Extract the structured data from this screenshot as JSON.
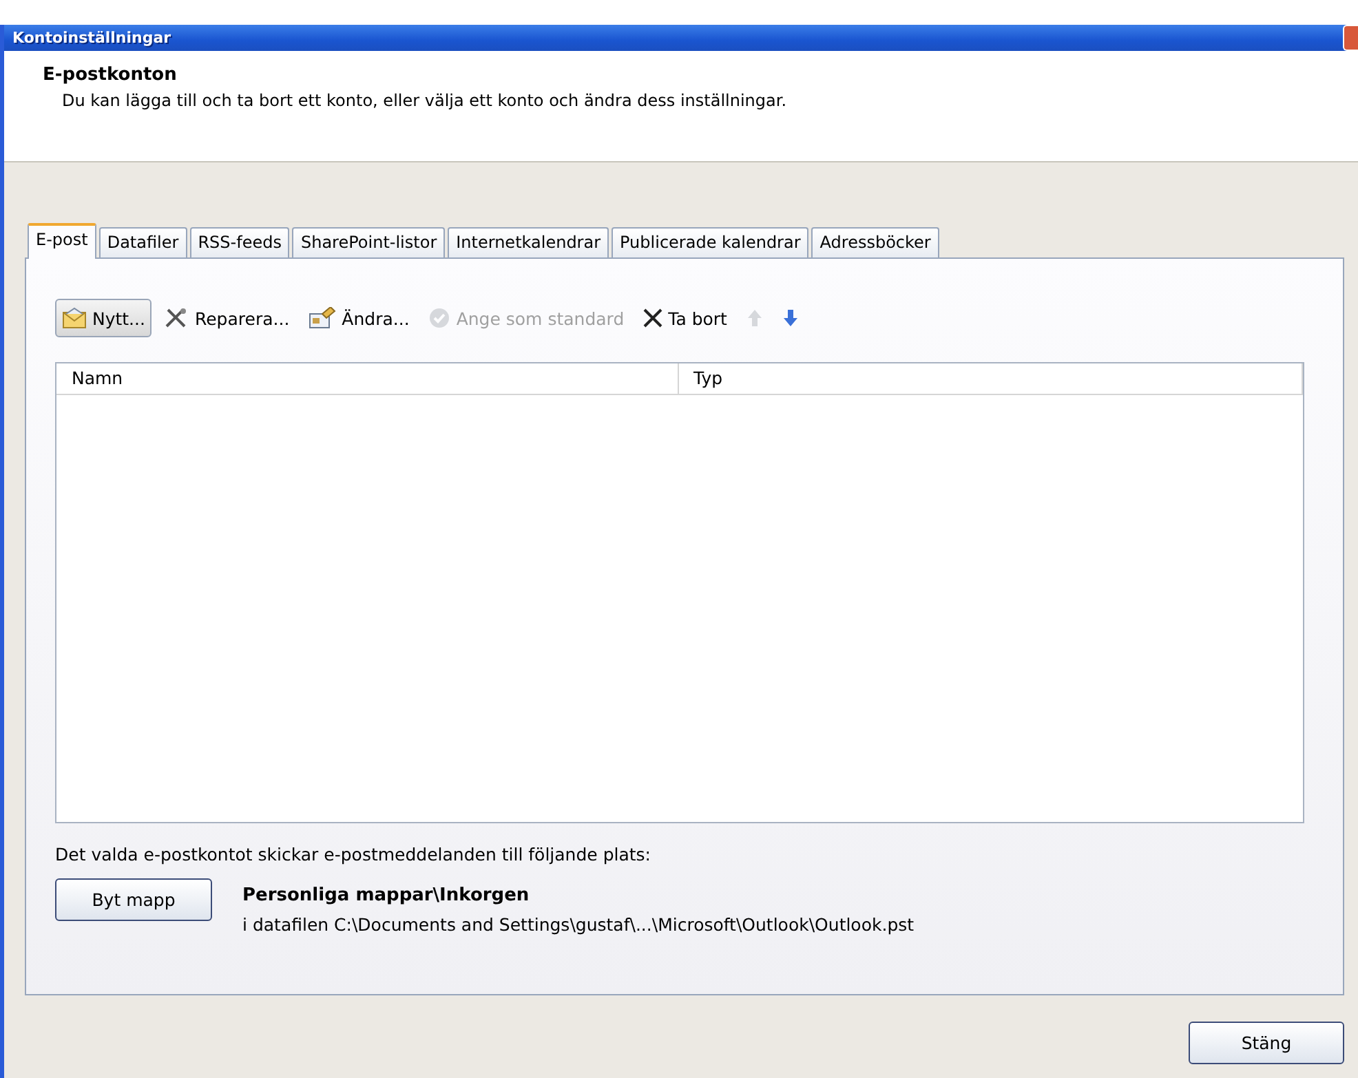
{
  "window": {
    "title": "Kontoinställningar"
  },
  "header": {
    "title": "E-postkonton",
    "description": "Du kan lägga till och ta bort ett konto, eller välja ett konto och ändra dess inställningar."
  },
  "tabs": [
    {
      "label": "E-post",
      "selected": true
    },
    {
      "label": "Datafiler",
      "selected": false
    },
    {
      "label": "RSS-feeds",
      "selected": false
    },
    {
      "label": "SharePoint-listor",
      "selected": false
    },
    {
      "label": "Internetkalendrar",
      "selected": false
    },
    {
      "label": "Publicerade kalendrar",
      "selected": false
    },
    {
      "label": "Adressböcker",
      "selected": false
    }
  ],
  "toolbar": [
    {
      "kind": "new",
      "label": "Nytt...",
      "pressed": true,
      "disabled": false
    },
    {
      "kind": "repair",
      "label": "Reparera...",
      "pressed": false,
      "disabled": false
    },
    {
      "kind": "change",
      "label": "Ändra...",
      "pressed": false,
      "disabled": false
    },
    {
      "kind": "default",
      "label": "Ange som standard",
      "pressed": false,
      "disabled": true
    },
    {
      "kind": "remove",
      "label": "Ta bort",
      "pressed": false,
      "disabled": false
    },
    {
      "kind": "up",
      "pressed": false,
      "disabled": true
    },
    {
      "kind": "down",
      "pressed": false,
      "disabled": false
    }
  ],
  "table": {
    "columns": [
      "Namn",
      "Typ"
    ]
  },
  "delivery": {
    "text": "Det valda e-postkontot skickar e-postmeddelanden till följande plats:",
    "button": "Byt mapp",
    "folder": "Personliga mappar\\Inkorgen",
    "file": "i datafilen C:\\Documents and Settings\\gustaf\\...\\Microsoft\\Outlook\\Outlook.pst"
  },
  "buttons": [
    "Stäng"
  ]
}
